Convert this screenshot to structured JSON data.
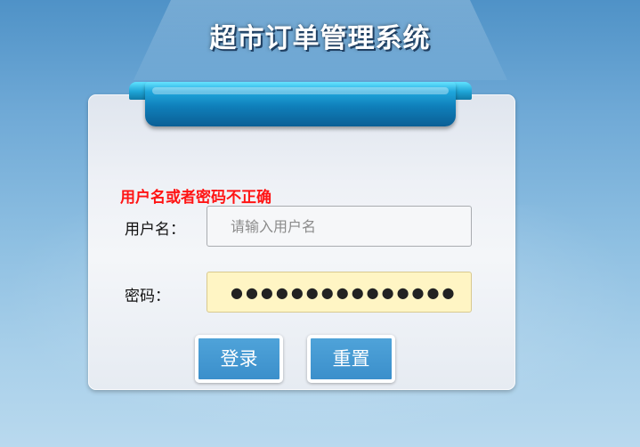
{
  "app": {
    "title": "超市订单管理系统"
  },
  "login": {
    "error_message": "用户名或者密码不正确",
    "username_label": "用户名：",
    "username_value": "",
    "username_placeholder": "请输入用户名",
    "password_label": "密码：",
    "password_value": "●●●●●●●●●●●●●●●",
    "login_button_label": "登录",
    "reset_button_label": "重置"
  },
  "colors": {
    "error": "#ff1414",
    "button": "#3b8fcb",
    "ribbon": "#1fa6dc",
    "password_field_bg": "#fff5c4"
  }
}
